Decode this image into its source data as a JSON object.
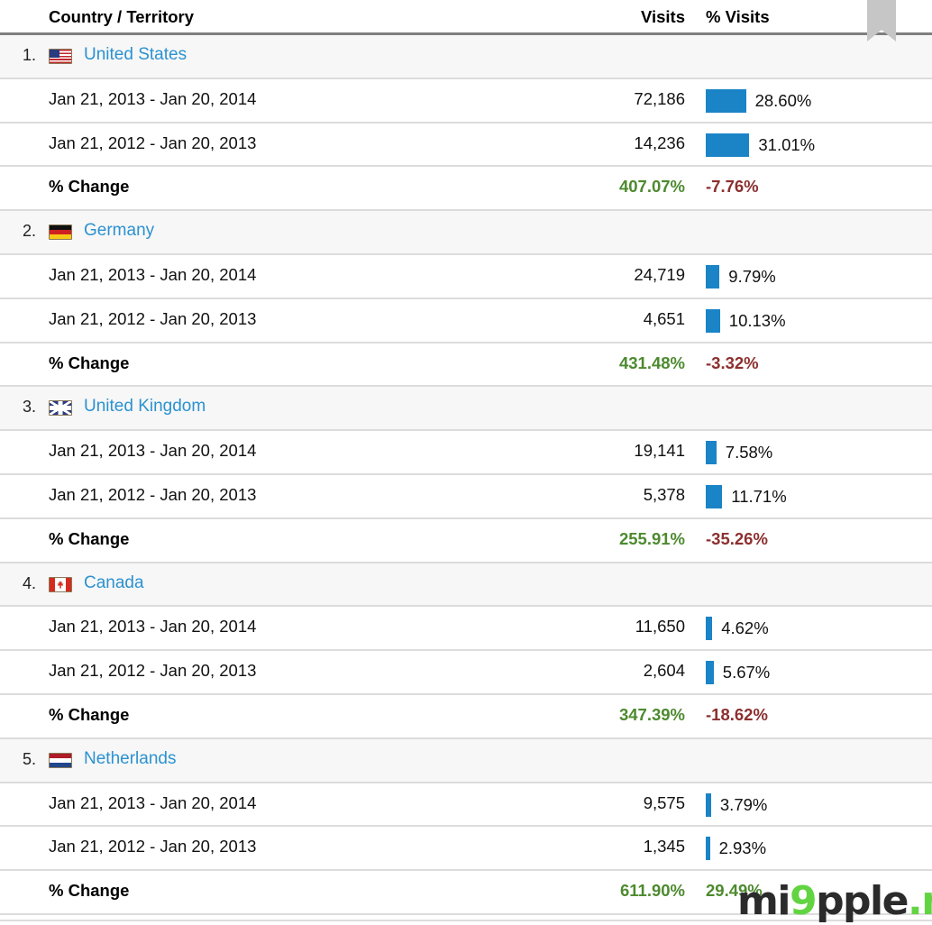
{
  "table": {
    "columns": {
      "country": "Country / Territory",
      "visits": "Visits",
      "pct_visits": "% Visits"
    },
    "period_current": "Jan 21, 2013 - Jan 20, 2014",
    "period_previous": "Jan 21, 2012 - Jan 20, 2013",
    "change_label": "% Change",
    "colors": {
      "bar": "#1a84c7",
      "link": "#2b92d0",
      "positive": "#4d8a2f",
      "negative": "#8c2f2f",
      "header_rule": "#7f7f7f",
      "row_rule": "#dcdcdc",
      "country_row_bg": "#f7f7f7",
      "scrollbar": "#c6c6c6"
    },
    "rows": [
      {
        "rank": "1.",
        "country": "United States",
        "flag": "flag-us-icon",
        "current": {
          "date": "Jan 21, 2013 - Jan 20, 2014",
          "visits": "72,186",
          "pct": "28.60%",
          "pct_value": 28.6
        },
        "previous": {
          "date": "Jan 21, 2012 - Jan 20, 2013",
          "visits": "14,236",
          "pct": "31.01%",
          "pct_value": 31.01
        },
        "change": {
          "label": "% Change",
          "visits": "407.07%",
          "pct": "-7.76%",
          "visits_sign": "positive",
          "pct_sign": "negative"
        }
      },
      {
        "rank": "2.",
        "country": "Germany",
        "flag": "flag-de-icon",
        "current": {
          "date": "Jan 21, 2013 - Jan 20, 2014",
          "visits": "24,719",
          "pct": "9.79%",
          "pct_value": 9.79
        },
        "previous": {
          "date": "Jan 21, 2012 - Jan 20, 2013",
          "visits": "4,651",
          "pct": "10.13%",
          "pct_value": 10.13
        },
        "change": {
          "label": "% Change",
          "visits": "431.48%",
          "pct": "-3.32%",
          "visits_sign": "positive",
          "pct_sign": "negative"
        }
      },
      {
        "rank": "3.",
        "country": "United Kingdom",
        "flag": "flag-gb-icon",
        "current": {
          "date": "Jan 21, 2013 - Jan 20, 2014",
          "visits": "19,141",
          "pct": "7.58%",
          "pct_value": 7.58
        },
        "previous": {
          "date": "Jan 21, 2012 - Jan 20, 2013",
          "visits": "5,378",
          "pct": "11.71%",
          "pct_value": 11.71
        },
        "change": {
          "label": "% Change",
          "visits": "255.91%",
          "pct": "-35.26%",
          "visits_sign": "positive",
          "pct_sign": "negative"
        }
      },
      {
        "rank": "4.",
        "country": "Canada",
        "flag": "flag-ca-icon",
        "current": {
          "date": "Jan 21, 2013 - Jan 20, 2014",
          "visits": "11,650",
          "pct": "4.62%",
          "pct_value": 4.62
        },
        "previous": {
          "date": "Jan 21, 2012 - Jan 20, 2013",
          "visits": "2,604",
          "pct": "5.67%",
          "pct_value": 5.67
        },
        "change": {
          "label": "% Change",
          "visits": "347.39%",
          "pct": "-18.62%",
          "visits_sign": "positive",
          "pct_sign": "negative"
        }
      },
      {
        "rank": "5.",
        "country": "Netherlands",
        "flag": "flag-nl-icon",
        "current": {
          "date": "Jan 21, 2013 - Jan 20, 2014",
          "visits": "9,575",
          "pct": "3.79%",
          "pct_value": 3.79
        },
        "previous": {
          "date": "Jan 21, 2012 - Jan 20, 2013",
          "visits": "1,345",
          "pct": "2.93%",
          "pct_value": 2.93
        },
        "change": {
          "label": "% Change",
          "visits": "611.90%",
          "pct": "29.49%",
          "visits_sign": "positive",
          "pct_sign": "positive"
        }
      }
    ]
  },
  "watermark": {
    "part1": "mi",
    "part2": "9",
    "part3": "pple",
    "part4": ".me"
  }
}
